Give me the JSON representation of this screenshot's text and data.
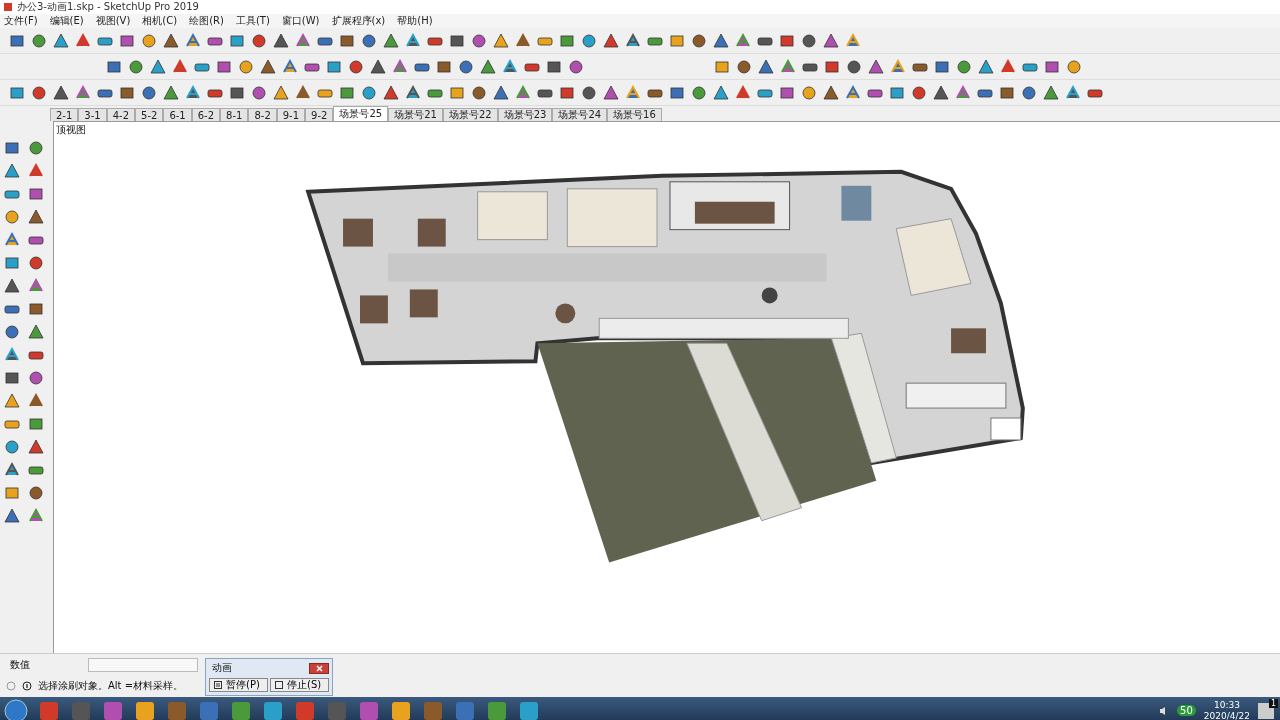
{
  "window": {
    "title": "办公3-动画1.skp - SketchUp Pro 2019"
  },
  "menu": [
    "文件(F)",
    "编辑(E)",
    "视图(V)",
    "相机(C)",
    "绘图(R)",
    "工具(T)",
    "窗口(W)",
    "扩展程序(x)",
    "帮助(H)"
  ],
  "scene_tabs": [
    {
      "label": "2-1",
      "selected": false
    },
    {
      "label": "3-1",
      "selected": false
    },
    {
      "label": "4-2",
      "selected": false
    },
    {
      "label": "5-2",
      "selected": false
    },
    {
      "label": "6-1",
      "selected": false
    },
    {
      "label": "6-2",
      "selected": false
    },
    {
      "label": "8-1",
      "selected": false
    },
    {
      "label": "8-2",
      "selected": false
    },
    {
      "label": "9-1",
      "selected": false
    },
    {
      "label": "9-2",
      "selected": false
    },
    {
      "label": "场景号25",
      "selected": true
    },
    {
      "label": "场景号21",
      "selected": false
    },
    {
      "label": "场景号22",
      "selected": false
    },
    {
      "label": "场景号23",
      "selected": false
    },
    {
      "label": "场景号24",
      "selected": false
    },
    {
      "label": "场景号16",
      "selected": false
    }
  ],
  "viewport": {
    "view_label": "顶视图"
  },
  "measurements": {
    "label": "数值"
  },
  "status": {
    "message": "选择涂刷对象。Alt =材料采样。"
  },
  "animation_dialog": {
    "title": "动画",
    "buttons": [
      {
        "label": "暂停(P)",
        "kind": "pause"
      },
      {
        "label": "停止(S)",
        "kind": "stop"
      }
    ]
  },
  "taskbar": {
    "tray_badge": "50",
    "time": "10:33",
    "date": "2020/4/22",
    "notification_count": "1"
  }
}
